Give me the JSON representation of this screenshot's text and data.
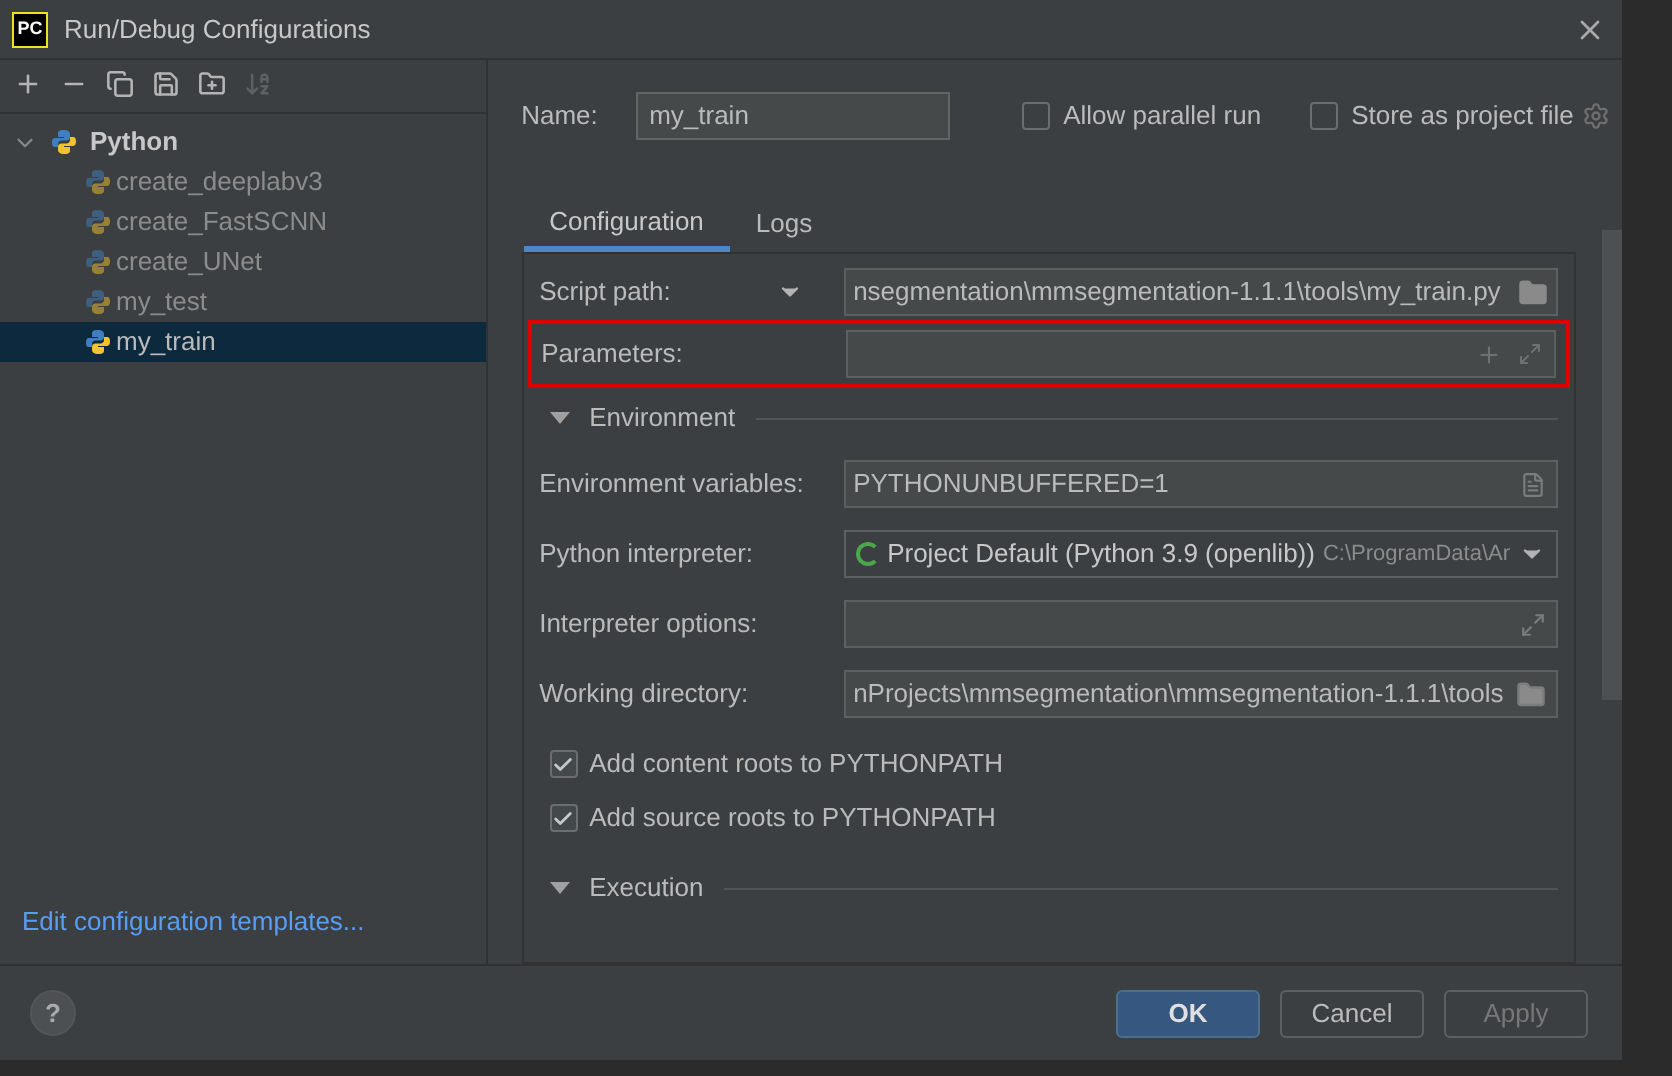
{
  "window": {
    "title": "Run/Debug Configurations",
    "logo": "PC"
  },
  "toolbar": [
    {
      "kind": "add",
      "disabled": false
    },
    {
      "kind": "remove",
      "disabled": false
    },
    {
      "kind": "copy",
      "disabled": false
    },
    {
      "kind": "save",
      "disabled": false
    },
    {
      "kind": "folder",
      "disabled": false
    },
    {
      "kind": "sort",
      "disabled": true
    }
  ],
  "tree": [
    {
      "label": "Python",
      "expanded": true,
      "selected": false,
      "children": [
        {
          "label": "create_deeplabv3",
          "selected": false,
          "temporary": true
        },
        {
          "label": "create_FastSCNN",
          "selected": false,
          "temporary": true
        },
        {
          "label": "create_UNet",
          "selected": false,
          "temporary": true
        },
        {
          "label": "my_test",
          "selected": false,
          "temporary": true
        },
        {
          "label": "my_train",
          "selected": true,
          "temporary": false
        }
      ]
    }
  ],
  "templates_link": "Edit configuration templates...",
  "name_field": {
    "label": "Name:",
    "value": "my_train"
  },
  "options": [
    {
      "label": "Allow parallel run",
      "checked": false
    },
    {
      "label": "Store as project file",
      "checked": false
    }
  ],
  "tabs": [
    {
      "label": "Configuration",
      "selected": true
    },
    {
      "label": "Logs",
      "selected": false
    }
  ],
  "script_row": {
    "label": "Script path:",
    "value": "nsegmentation\\mmsegmentation-1.1.1\\tools\\my_train.py"
  },
  "parameters_row": {
    "label": "Parameters:",
    "highlighted": true
  },
  "sections": [
    {
      "title": "Environment",
      "expanded": true
    },
    {
      "title": "Execution",
      "expanded": true
    }
  ],
  "environment_rows": [
    {
      "kind": "list",
      "label": "Environment variables:",
      "value": "PYTHONUNBUFFERED=1"
    },
    {
      "kind": "interpreter",
      "label": "Python interpreter:",
      "value": "Project Default (Python 3.9 (openlib))",
      "hint": "C:\\ProgramData\\Ar"
    },
    {
      "kind": "expand",
      "label": "Interpreter options:"
    },
    {
      "kind": "folder",
      "label": "Working directory:",
      "value": "nProjects\\mmsegmentation\\mmsegmentation-1.1.1\\tools"
    }
  ],
  "path_options": [
    {
      "label": "Add content roots to PYTHONPATH",
      "checked": true
    },
    {
      "label": "Add source roots to PYTHONPATH",
      "checked": true
    }
  ],
  "buttons": [
    {
      "label": "OK",
      "primary": true,
      "disabled": false
    },
    {
      "label": "Cancel",
      "primary": false,
      "disabled": false
    },
    {
      "label": "Apply",
      "primary": false,
      "disabled": true
    }
  ],
  "help": "?"
}
